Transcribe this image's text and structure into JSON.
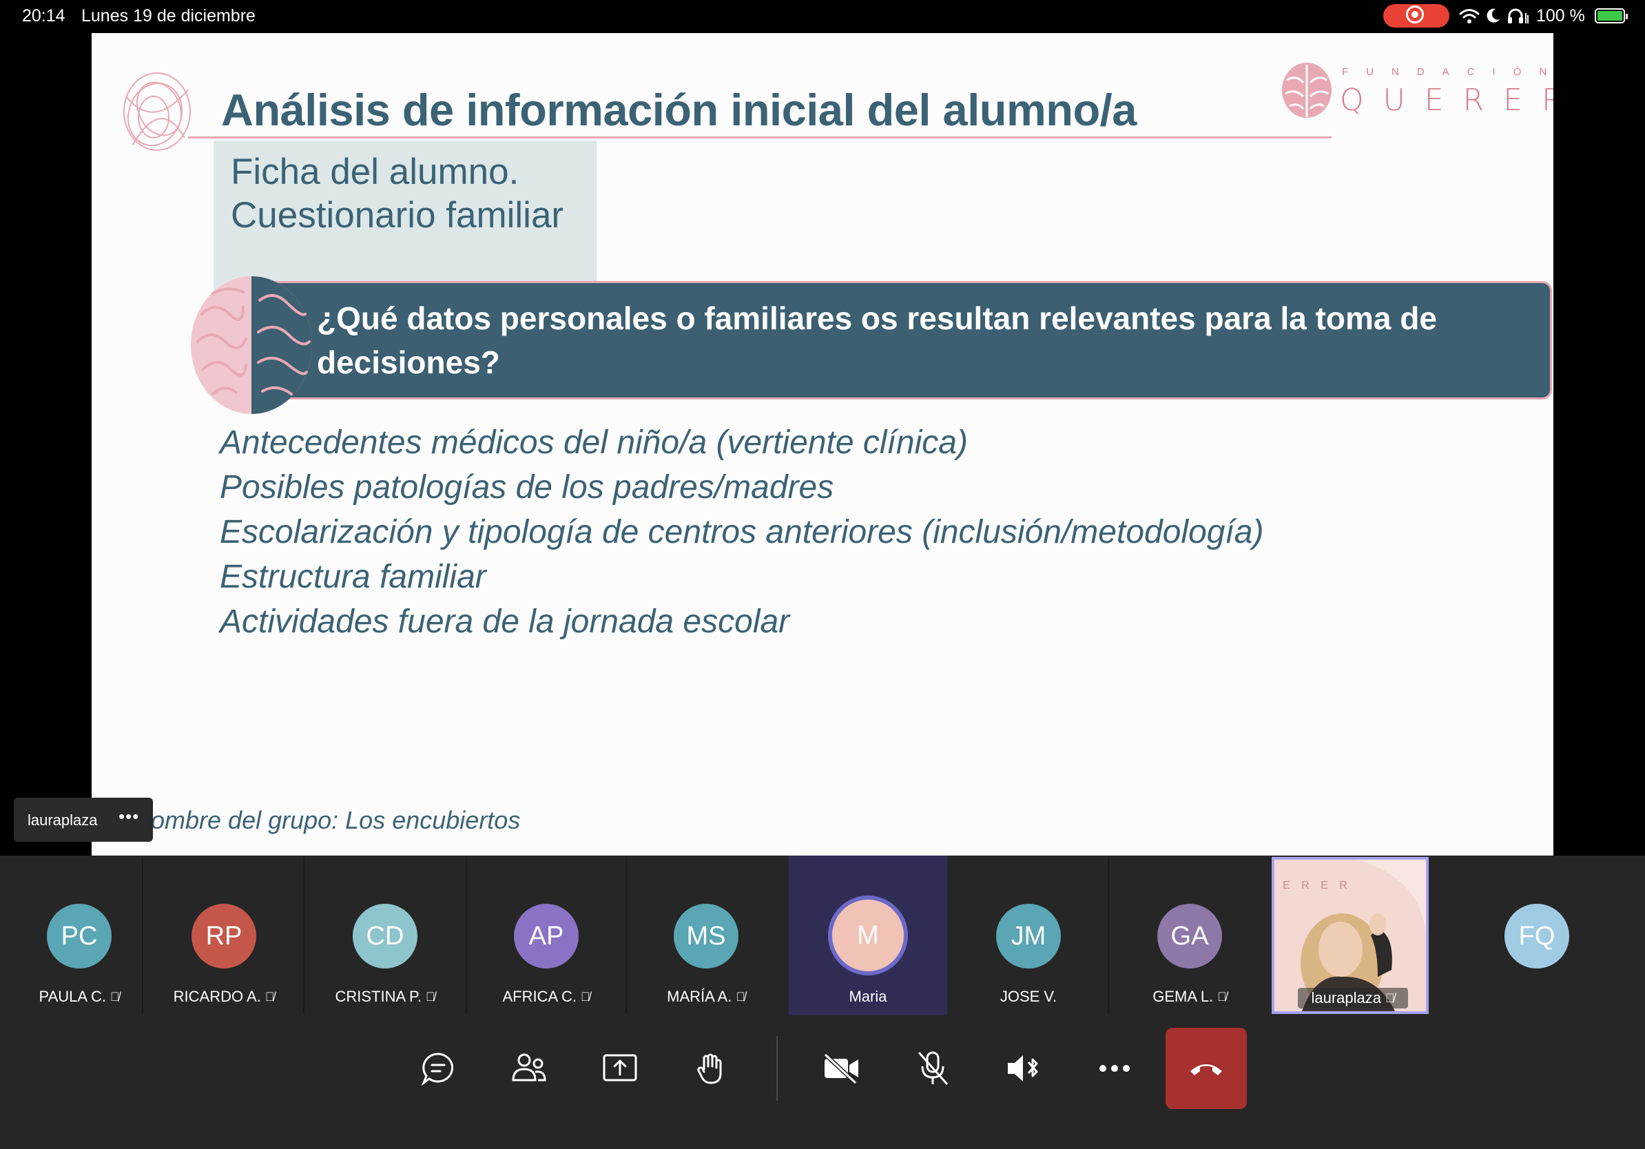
{
  "status_bar": {
    "time": "20:14",
    "date": "Lunes 19 de diciembre",
    "battery": "100 %"
  },
  "slide": {
    "title": "Análisis de información inicial del alumno/a",
    "subtitle_lines": [
      "Ficha del alumno.",
      "Cuestionario familiar"
    ],
    "question": "¿Qué datos personales o familiares os resultan relevantes para la toma de decisiones?",
    "bullets": [
      "Antecedentes médicos del niño/a (vertiente clínica)",
      "Posibles patologías de los padres/madres",
      "Escolarización y tipología de centros anteriores (inclusión/metodología)",
      "Estructura familiar",
      "Actividades fuera de la jornada escolar"
    ],
    "group_name": "ombre del grupo: Los encubiertos",
    "logo": {
      "small": "FUNDACIÓN",
      "big": "QUERER"
    }
  },
  "presenter": {
    "name": "lauraplaza",
    "more": "•••"
  },
  "participants": [
    {
      "initials": "PC",
      "name": "PAULA C.",
      "muted": true,
      "color": "#5aa6b4"
    },
    {
      "initials": "RP",
      "name": "RICARDO A.",
      "muted": true,
      "color": "#c4574a"
    },
    {
      "initials": "CD",
      "name": "CRISTINA P.",
      "muted": true,
      "color": "#8ec4cc"
    },
    {
      "initials": "AP",
      "name": "AFRICA C.",
      "muted": true,
      "color": "#8a72c5"
    },
    {
      "initials": "MS",
      "name": "MARÍA A.",
      "muted": true,
      "color": "#5aa6b4"
    },
    {
      "initials": "M",
      "name": "Maria",
      "muted": false,
      "color": "#f0c3b6"
    },
    {
      "initials": "JM",
      "name": "JOSE V.",
      "muted": false,
      "color": "#5aa6b4"
    },
    {
      "initials": "GA",
      "name": "GEMA L.",
      "muted": true,
      "color": "#8e78a8"
    }
  ],
  "video_participant": {
    "name": "lauraplaza",
    "muted": true
  },
  "extra_participant": {
    "initials": "FQ",
    "color": "#9fcbe3"
  },
  "controls": [
    "chat",
    "people",
    "share",
    "raise-hand",
    "camera-off",
    "mic-off",
    "speaker",
    "more",
    "hang-up"
  ]
}
